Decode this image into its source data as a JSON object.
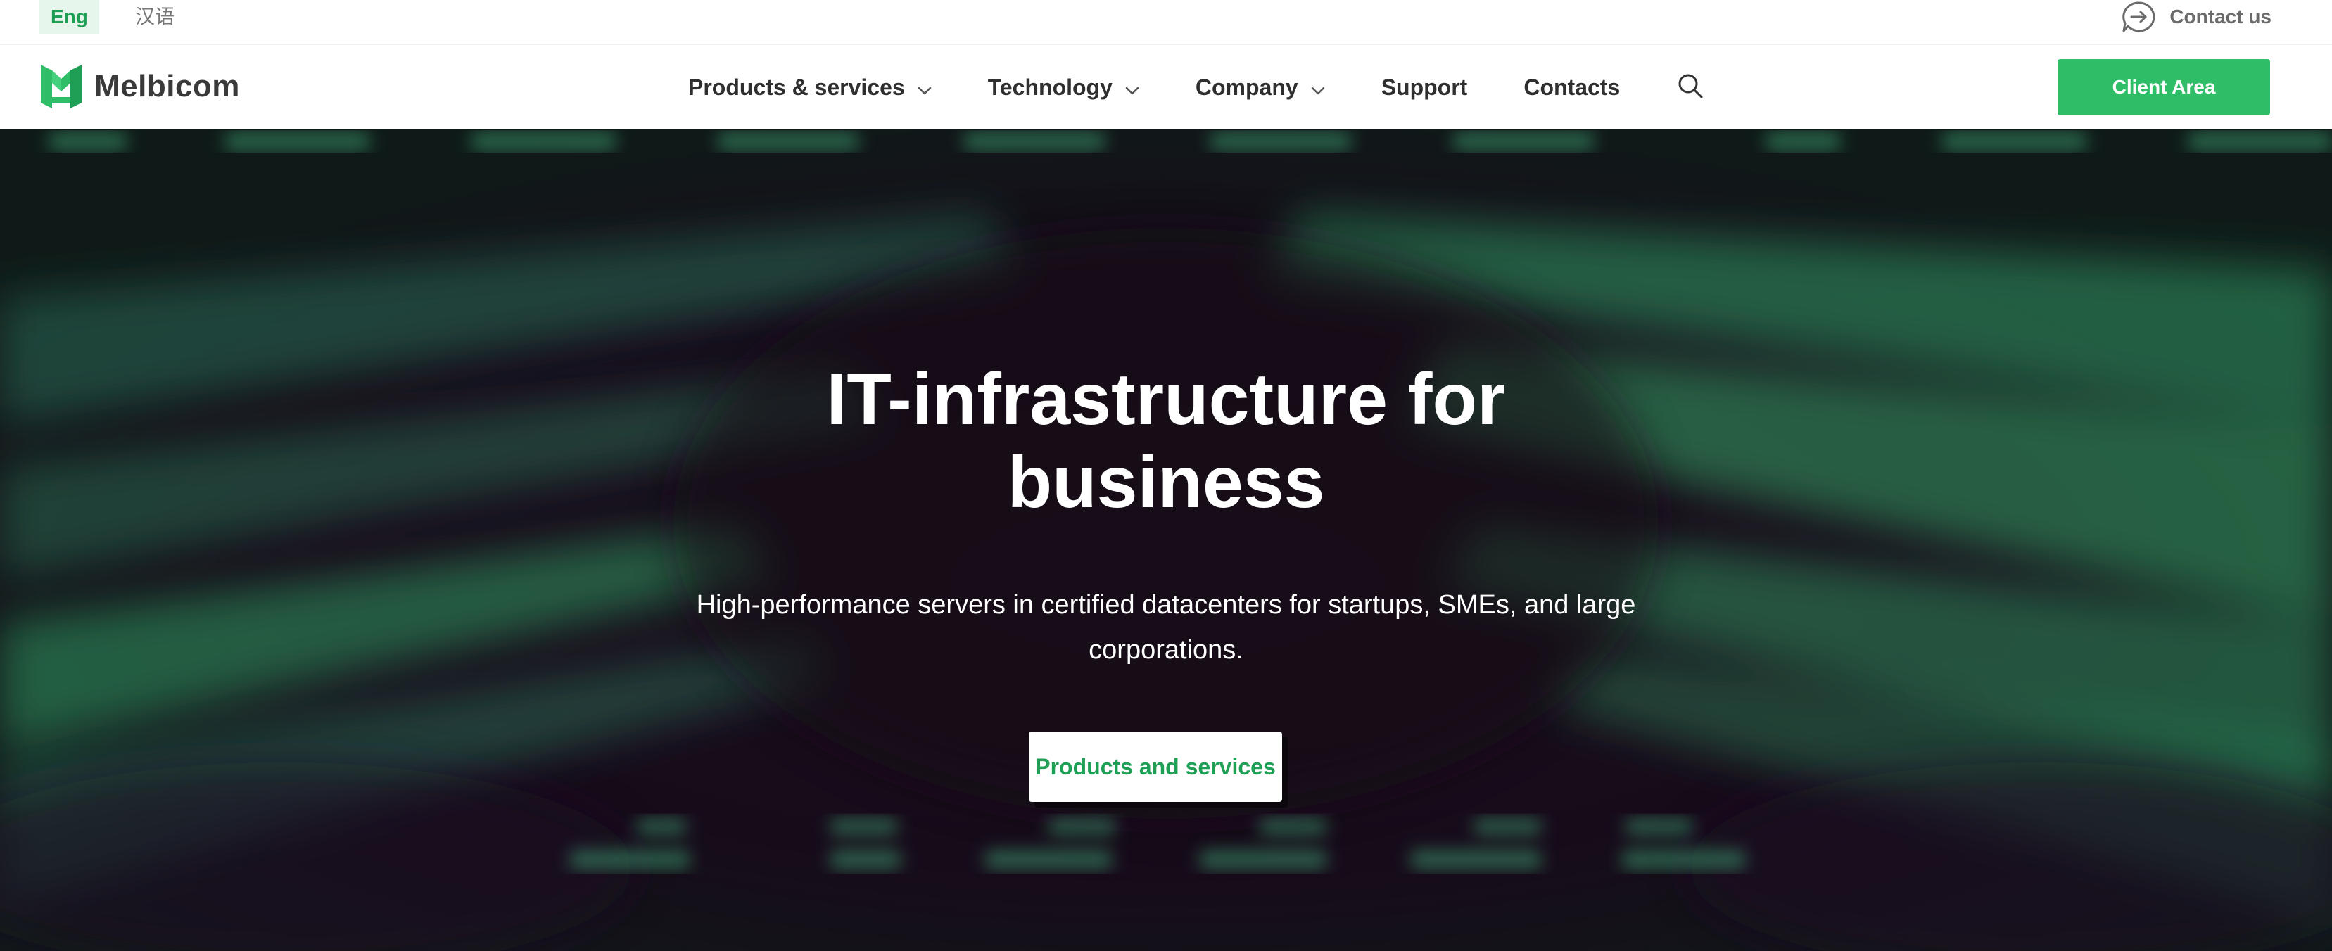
{
  "topbar": {
    "languages": [
      {
        "label": "Eng",
        "active": true
      },
      {
        "label": "汉语",
        "active": false
      }
    ],
    "contact": {
      "label": "Contact us",
      "icon": "chat-arrow-icon"
    }
  },
  "navbar": {
    "logo_text": "Melbicom",
    "items": [
      {
        "label": "Products & services",
        "has_dropdown": true
      },
      {
        "label": "Technology",
        "has_dropdown": true
      },
      {
        "label": "Company",
        "has_dropdown": true
      },
      {
        "label": "Support",
        "has_dropdown": false
      },
      {
        "label": "Contacts",
        "has_dropdown": false
      }
    ],
    "search_icon": "search-icon",
    "client_area_label": "Client Area"
  },
  "hero": {
    "title_line1": "IT-infrastructure for",
    "title_line2": "business",
    "subtitle": "High-performance servers in certified datacenters for startups, SMEs, and large corporations.",
    "cta_label": "Products and services"
  },
  "colors": {
    "brand_green": "#2fbd67",
    "brand_green_dark": "#1f9f55",
    "hero_background": "#140a17",
    "nav_text": "#2f2f2f"
  }
}
